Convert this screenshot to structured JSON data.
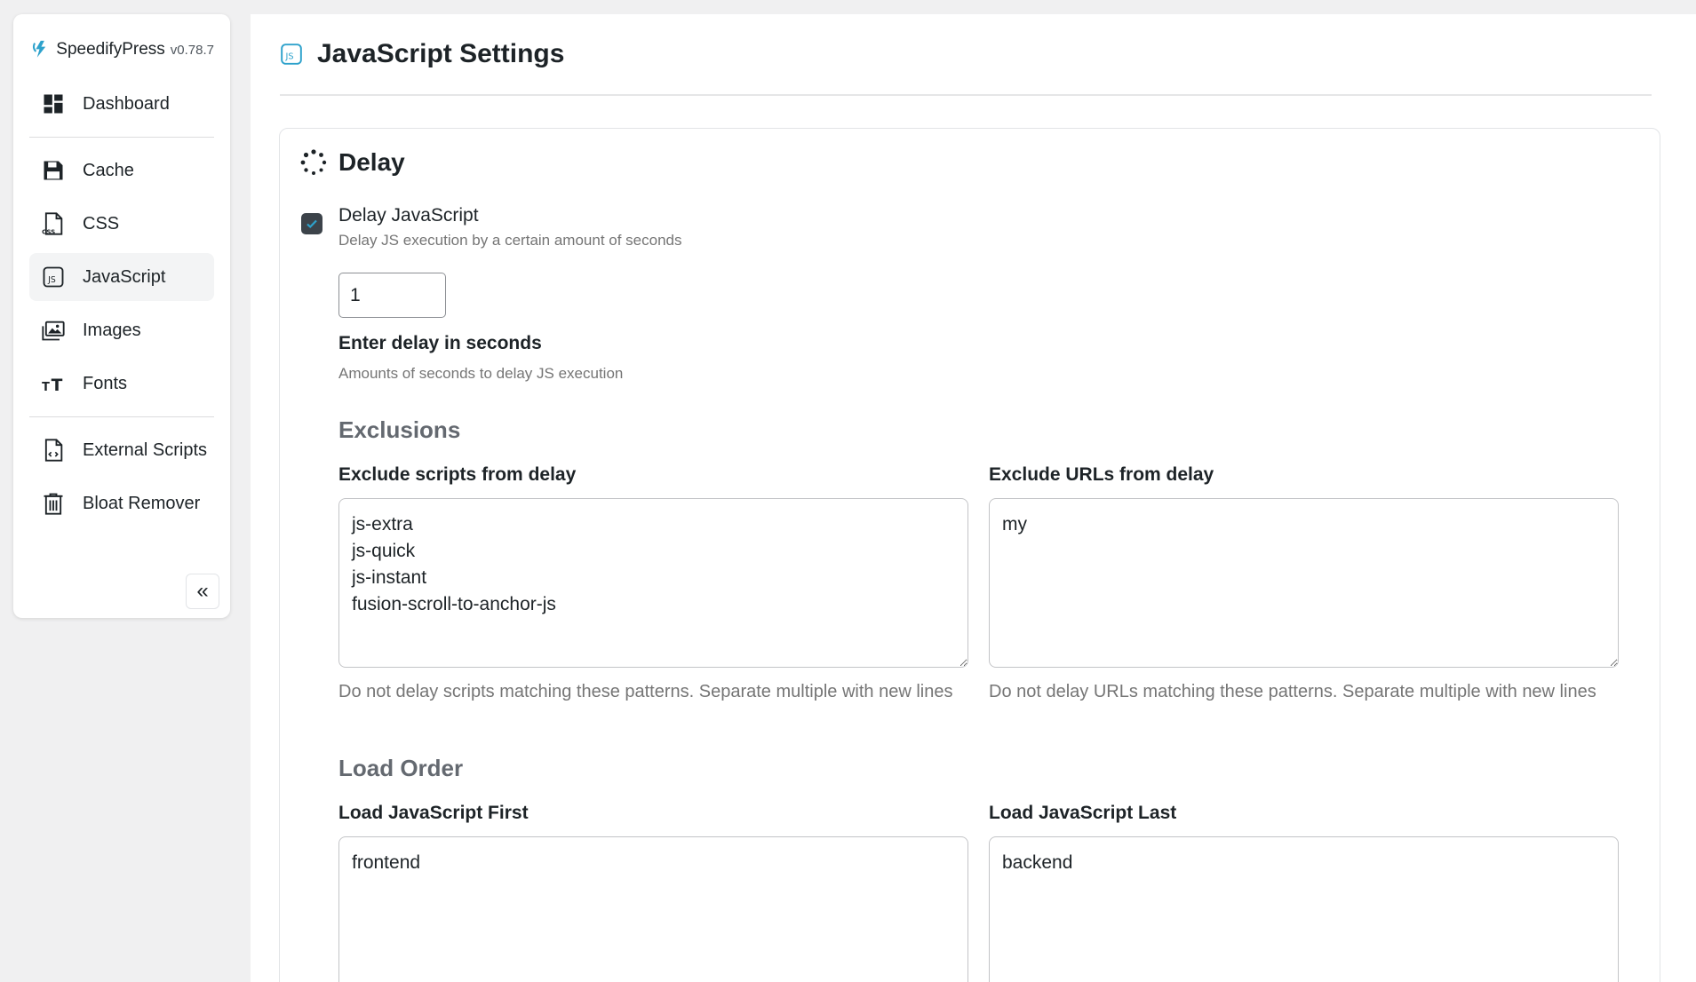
{
  "brand": {
    "name": "SpeedifyPress",
    "version": "v0.78.7"
  },
  "sidebar": {
    "items": [
      {
        "label": "Dashboard",
        "icon": "dashboard-icon"
      },
      {
        "label": "Cache",
        "icon": "floppy-disk-icon"
      },
      {
        "label": "CSS",
        "icon": "css-file-icon"
      },
      {
        "label": "JavaScript",
        "icon": "js-file-icon",
        "active": true
      },
      {
        "label": "Images",
        "icon": "images-icon"
      },
      {
        "label": "Fonts",
        "icon": "font-size-icon"
      },
      {
        "label": "External Scripts",
        "icon": "external-scripts-icon"
      },
      {
        "label": "Bloat Remover",
        "icon": "trash-icon"
      }
    ],
    "collapse_label": "«"
  },
  "page": {
    "title": "JavaScript Settings"
  },
  "delay": {
    "title": "Delay",
    "checkbox": {
      "label": "Delay JavaScript",
      "description": "Delay JS execution by a certain amount of seconds",
      "checked": true
    },
    "seconds": {
      "value": "1",
      "label": "Enter delay in seconds",
      "help": "Amounts of seconds to delay JS execution"
    }
  },
  "exclusions": {
    "heading": "Exclusions",
    "scripts": {
      "label": "Exclude scripts from delay",
      "value": "js-extra\njs-quick\njs-instant\nfusion-scroll-to-anchor-js",
      "help": "Do not delay scripts matching these patterns. Separate multiple with new lines"
    },
    "urls": {
      "label": "Exclude URLs from delay",
      "value": "my",
      "help": "Do not delay URLs matching these patterns. Separate multiple with new lines"
    }
  },
  "load_order": {
    "heading": "Load Order",
    "first": {
      "label": "Load JavaScript First",
      "value": "frontend"
    },
    "last": {
      "label": "Load JavaScript Last",
      "value": "backend"
    }
  },
  "colors": {
    "accent": "#2ea2cc",
    "checkbox": "#3c434a",
    "muted_text": "#757575"
  }
}
